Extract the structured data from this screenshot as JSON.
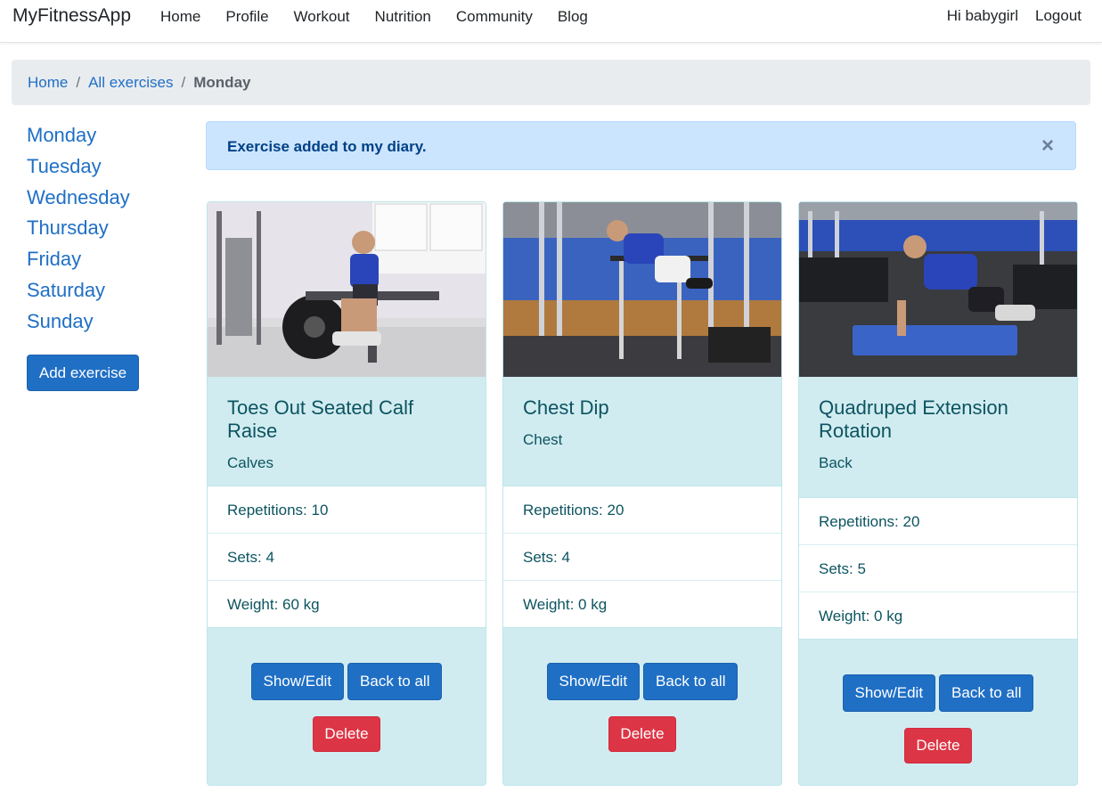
{
  "navbar": {
    "brand": "MyFitnessApp",
    "links": [
      "Home",
      "Profile",
      "Workout",
      "Nutrition",
      "Community",
      "Blog"
    ],
    "greeting": "Hi babygirl",
    "logout": "Logout"
  },
  "breadcrumb": {
    "items": [
      "Home",
      "All exercises"
    ],
    "active": "Monday",
    "separator": "/"
  },
  "sidebar": {
    "days": [
      "Monday",
      "Tuesday",
      "Wednesday",
      "Thursday",
      "Friday",
      "Saturday",
      "Sunday"
    ],
    "add_button": "Add exercise"
  },
  "alert": {
    "message": "Exercise added to my diary.",
    "close": "×"
  },
  "cards": [
    {
      "title": "Toes Out Seated Calf Raise",
      "muscle": "Calves",
      "reps": "Repetitions: 10",
      "sets": "Sets: 4",
      "weight": "Weight: 60 kg",
      "show_edit": "Show/Edit",
      "back": "Back to all",
      "delete": "Delete"
    },
    {
      "title": "Chest Dip",
      "muscle": "Chest",
      "reps": "Repetitions: 20",
      "sets": "Sets: 4",
      "weight": "Weight: 0 kg",
      "show_edit": "Show/Edit",
      "back": "Back to all",
      "delete": "Delete"
    },
    {
      "title": "Quadruped Extension Rotation",
      "muscle": "Back",
      "reps": "Repetitions: 20",
      "sets": "Sets: 5",
      "weight": "Weight: 0 kg",
      "show_edit": "Show/Edit",
      "back": "Back to all",
      "delete": "Delete"
    }
  ],
  "colors": {
    "primary": "#1f6fc5",
    "danger": "#dc3545",
    "info_bg": "#d1ecf1",
    "info_text": "#0c5460",
    "alert_bg": "#cce5ff",
    "alert_text": "#004085"
  }
}
